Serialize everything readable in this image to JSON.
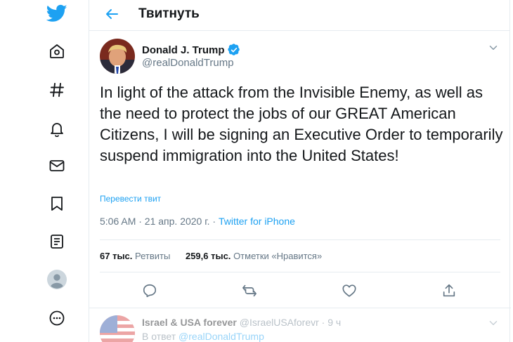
{
  "sidebar": {
    "items": [
      {
        "name": "twitter-logo",
        "icon": "twitter-bird-icon"
      },
      {
        "name": "home",
        "icon": "home-icon"
      },
      {
        "name": "explore",
        "icon": "hashtag-icon"
      },
      {
        "name": "notifications",
        "icon": "bell-icon"
      },
      {
        "name": "messages",
        "icon": "envelope-icon"
      },
      {
        "name": "bookmarks",
        "icon": "bookmark-icon"
      },
      {
        "name": "lists",
        "icon": "list-icon"
      },
      {
        "name": "profile",
        "icon": "profile-icon"
      },
      {
        "name": "more",
        "icon": "more-icon"
      }
    ]
  },
  "header": {
    "title": "Твитнуть"
  },
  "tweet": {
    "author_name": "Donald J. Trump",
    "author_handle": "@realDonaldTrump",
    "text": "In light of the attack from the Invisible Enemy, as well as the need to protect the jobs of our GREAT American Citizens, I will be signing an Executive Order to temporarily suspend immigration into the United States!",
    "translate_label": "Перевести твит",
    "timestamp": "5:06 AM · 21 апр. 2020 г. · ",
    "source": "Twitter for iPhone",
    "retweets_count": "67 тыс.",
    "retweets_label": "Ретвиты",
    "likes_count": "259,6 тыс.",
    "likes_label": "Отметки «Нравится»"
  },
  "reply": {
    "author_name": "Israel & USA forever",
    "author_handle": "@IsraelUSAforevr",
    "time": " · 9 ч",
    "reply_prefix": "В ответ ",
    "reply_to": "@realDonaldTrump"
  },
  "colors": {
    "accent": "#1da1f2",
    "text": "#14171a",
    "secondary": "#657786",
    "border": "#e6ecf0"
  }
}
